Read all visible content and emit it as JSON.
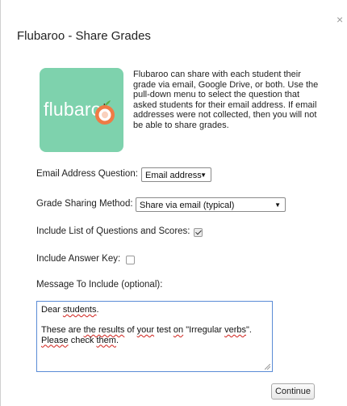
{
  "dialog": {
    "title": "Flubaroo - Share Grades",
    "close_glyph": "×"
  },
  "logo": {
    "text": "flubaroo",
    "bg_color": "#7ed2ad",
    "icon": "apple-icon"
  },
  "intro_text": "Flubaroo can share with each student their grade via email, Google Drive, or both. Use the pull-down menu to select the question that asked students for their email address. If email addresses were not collected, then you will not be able to share grades.",
  "form": {
    "email_question_label": "Email Address Question:",
    "email_question_value": "Email address",
    "sharing_method_label": "Grade Sharing Method:",
    "sharing_method_value": "Share via email (typical)",
    "include_list_label": "Include List of Questions and Scores:",
    "include_list_checked": true,
    "include_key_label": "Include Answer Key:",
    "include_key_checked": false,
    "message_label": "Message To Include (optional):",
    "message_text": {
      "line1_a": "Dear ",
      "line1_b": "students",
      "line1_c": ".",
      "line2_a": "These are ",
      "line2_b": "the results",
      "line2_c": " of ",
      "line2_d": "your",
      "line2_e": " test ",
      "line2_f": "on",
      "line2_g": " \"Irregular ",
      "line2_h": "verbs",
      "line2_i": "\".",
      "line3_a": "Please",
      "line3_b": " check ",
      "line3_c": "them",
      "line3_d": "."
    }
  },
  "actions": {
    "continue_label": "Continue"
  },
  "colors": {
    "focus_border": "#5b8cd6",
    "spellcheck": "#d0201a"
  }
}
